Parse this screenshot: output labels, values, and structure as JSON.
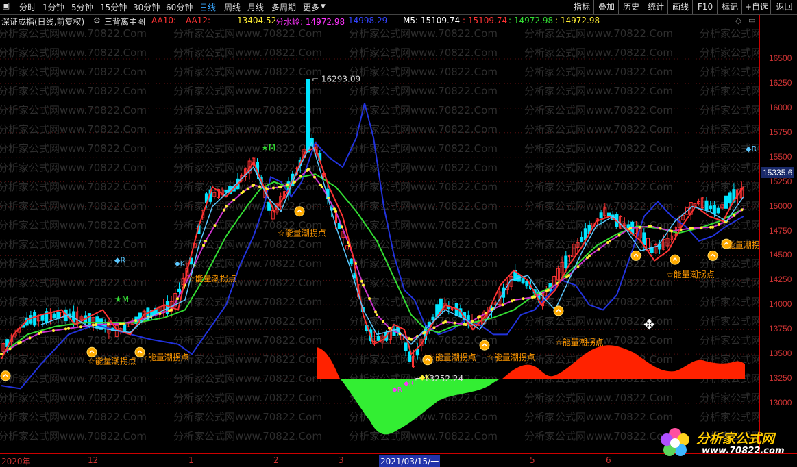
{
  "topbar": {
    "periods": [
      "分时",
      "1分钟",
      "5分钟",
      "15分钟",
      "30分钟",
      "60分钟",
      "日线",
      "周线",
      "月线",
      "多周期",
      "更多"
    ],
    "active_period": "日线",
    "tools": [
      "指标",
      "叠加",
      "历史",
      "统计",
      "画线",
      "F10",
      "标记",
      "+自选",
      "返回"
    ]
  },
  "header": {
    "title": "深证成指(日线,前复权)",
    "formula": "三背离主图",
    "aa10": "AA10: -",
    "aa12": "AA12: -",
    "v1": "13404.52",
    "fenshuiling": "分水岭: 14972.98",
    "v2": "14998.29",
    "m5": "M5: 15109.74",
    "v3": ": 15109.74",
    "v4": ": 14972.98",
    "v5": ": 14972.98"
  },
  "yaxis": {
    "labels": [
      "16500",
      "16250",
      "16000",
      "15750",
      "15500",
      "15250",
      "15000",
      "14750",
      "14500",
      "14250",
      "14000",
      "13750",
      "13500",
      "13250",
      "13000"
    ],
    "current": "15335.6"
  },
  "xaxis": {
    "labels": [
      "2020年",
      "12",
      "1",
      "2",
      "3",
      "2021/03/15/一",
      "5",
      "6"
    ]
  },
  "annotations": {
    "high": "16293.09",
    "low": "13252.24",
    "energy": "☆能量潮拐点",
    "mark_m": "★M",
    "mark_r": "◆R",
    "mark_k": "◆K"
  },
  "watermark": "分析家公式网www.70822.Com",
  "logo": {
    "title": "分析家公式网",
    "url": "www.70822.com"
  },
  "colors": {
    "up": "#ff3333",
    "down": "#00e5ff",
    "accent": "#39a7ff",
    "blue_line": "#2233dd",
    "green_line": "#33dd33",
    "dot_line": "#ffee33",
    "red_area": "#ff2200",
    "green_area": "#33ee33"
  }
}
